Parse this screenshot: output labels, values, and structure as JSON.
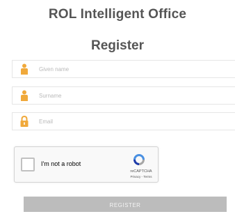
{
  "header": {
    "title": "ROL Intelligent Office",
    "subtitle": "Register"
  },
  "form": {
    "given_name": {
      "placeholder": "Given name",
      "value": "",
      "icon": "person-icon"
    },
    "surname": {
      "placeholder": "Surname",
      "value": "",
      "icon": "person-icon"
    },
    "email": {
      "placeholder": "Email",
      "value": "",
      "icon": "lock-icon"
    }
  },
  "captcha": {
    "label": "I'm not a robot",
    "brand": "reCAPTCHA",
    "terms": "Privacy - Terms",
    "checked": false
  },
  "submit": {
    "label": "REGISTER"
  },
  "colors": {
    "icon_accent": "#f0a93b",
    "button_bg": "#bcbcbc",
    "heading": "#555555"
  }
}
